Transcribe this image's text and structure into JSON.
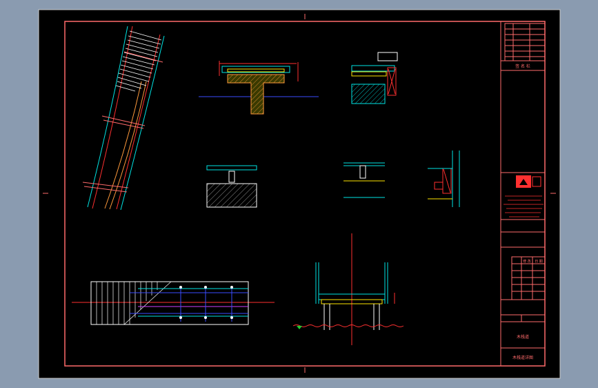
{
  "colors": {
    "backdrop": "#8a9bb0",
    "sheet": "#000000",
    "frame": "#ff6b6b",
    "cyan": "#00e5e5",
    "white": "#ffffff",
    "red": "#ff3030",
    "blue": "#3a4dff",
    "magenta": "#d040ff",
    "green": "#22cc33",
    "yellow": "#ffe600",
    "orange": "#ff9a3c"
  },
  "title_block": {
    "signatures": "签 名 栏",
    "revision_header_a": "修 改",
    "revision_header_b": "日 期",
    "sheet_number": "木栈道",
    "drawing_title": "木栈道详图"
  }
}
